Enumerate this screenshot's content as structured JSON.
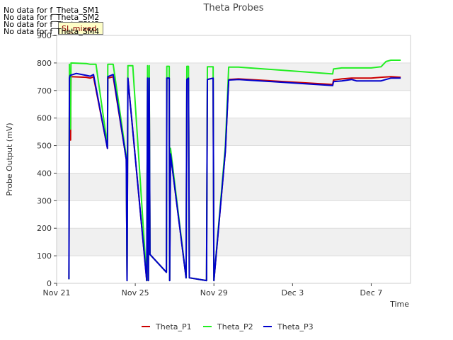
{
  "chart_data": {
    "type": "line",
    "title": "Theta Probes",
    "xlabel": "Time",
    "ylabel": "Probe Output (mV)",
    "xlim": [
      "2021-11-21",
      "2021-12-09"
    ],
    "ylim": [
      0,
      900
    ],
    "x_ticks": [
      "Nov 21",
      "Nov 25",
      "Nov 29",
      "Dec 3",
      "Dec 7"
    ],
    "y_ticks": [
      0,
      100,
      200,
      300,
      400,
      500,
      600,
      700,
      800,
      900
    ],
    "grid": true,
    "background_bands": true,
    "legend_position": "bottom-center",
    "series": [
      {
        "name": "Theta_P1",
        "color": "#cc0000",
        "points": [
          [
            "2021-11-21T15:00",
            15
          ],
          [
            "2021-11-21T15:40",
            750
          ],
          [
            "2021-11-21T17:00",
            520
          ],
          [
            "2021-11-21T17:30",
            750
          ],
          [
            "2021-11-22T12:00",
            748
          ],
          [
            "2021-11-22T17:00",
            745
          ],
          [
            "2021-11-22T21:00",
            750
          ],
          [
            "2021-11-23T14:00",
            490
          ],
          [
            "2021-11-23T14:30",
            745
          ],
          [
            "2021-11-23T21:00",
            750
          ],
          [
            "2021-11-24T13:00",
            450
          ],
          [
            "2021-11-24T14:00",
            10
          ],
          [
            "2021-11-24T15:00",
            745
          ],
          [
            "2021-11-25T14:00",
            10
          ],
          [
            "2021-11-25T15:00",
            745
          ],
          [
            "2021-11-25T16:00",
            10
          ],
          [
            "2021-11-25T17:00",
            745
          ],
          [
            "2021-11-25T18:00",
            105
          ],
          [
            "2021-11-26T14:00",
            40
          ],
          [
            "2021-11-26T14:30",
            745
          ],
          [
            "2021-11-26T17:30",
            745
          ],
          [
            "2021-11-26T18:00",
            10
          ],
          [
            "2021-11-26T19:00",
            470
          ],
          [
            "2021-11-27T14:00",
            20
          ],
          [
            "2021-11-27T15:00",
            740
          ],
          [
            "2021-11-27T17:00",
            745
          ],
          [
            "2021-11-27T18:00",
            20
          ],
          [
            "2021-11-28T15:00",
            10
          ],
          [
            "2021-11-28T16:00",
            740
          ],
          [
            "2021-11-28T23:00",
            745
          ],
          [
            "2021-11-29T00:00",
            10
          ],
          [
            "2021-11-29T14:00",
            480
          ],
          [
            "2021-11-29T18:00",
            740
          ],
          [
            "2021-11-30T06:00",
            742
          ],
          [
            "2021-12-05T01:00",
            722
          ],
          [
            "2021-12-05T02:00",
            738
          ],
          [
            "2021-12-05T12:00",
            742
          ],
          [
            "2021-12-06T00:00",
            745
          ],
          [
            "2021-12-07T00:00",
            745
          ],
          [
            "2021-12-07T12:00",
            748
          ],
          [
            "2021-12-08T00:00",
            750
          ],
          [
            "2021-12-08T12:00",
            748
          ]
        ]
      },
      {
        "name": "Theta_P2",
        "color": "#22ee22",
        "points": [
          [
            "2021-11-21T15:00",
            15
          ],
          [
            "2021-11-21T15:40",
            795
          ],
          [
            "2021-11-21T17:00",
            560
          ],
          [
            "2021-11-21T17:30",
            800
          ],
          [
            "2021-11-22T12:00",
            798
          ],
          [
            "2021-11-22T17:00",
            795
          ],
          [
            "2021-11-23T00:00",
            795
          ],
          [
            "2021-11-23T14:00",
            500
          ],
          [
            "2021-11-23T14:30",
            795
          ],
          [
            "2021-11-23T21:00",
            795
          ],
          [
            "2021-11-24T13:00",
            460
          ],
          [
            "2021-11-24T14:00",
            10
          ],
          [
            "2021-11-24T15:00",
            790
          ],
          [
            "2021-11-24T21:00",
            790
          ],
          [
            "2021-11-25T14:00",
            10
          ],
          [
            "2021-11-25T15:00",
            790
          ],
          [
            "2021-11-25T16:00",
            10
          ],
          [
            "2021-11-25T17:00",
            790
          ],
          [
            "2021-11-25T18:00",
            105
          ],
          [
            "2021-11-26T14:00",
            40
          ],
          [
            "2021-11-26T14:30",
            788
          ],
          [
            "2021-11-26T17:30",
            788
          ],
          [
            "2021-11-26T18:00",
            10
          ],
          [
            "2021-11-26T19:00",
            490
          ],
          [
            "2021-11-27T14:00",
            20
          ],
          [
            "2021-11-27T15:00",
            788
          ],
          [
            "2021-11-27T17:00",
            788
          ],
          [
            "2021-11-27T18:00",
            20
          ],
          [
            "2021-11-28T15:00",
            10
          ],
          [
            "2021-11-28T16:00",
            786
          ],
          [
            "2021-11-28T23:00",
            786
          ],
          [
            "2021-11-29T00:00",
            10
          ],
          [
            "2021-11-29T14:00",
            500
          ],
          [
            "2021-11-29T18:00",
            785
          ],
          [
            "2021-11-30T06:00",
            785
          ],
          [
            "2021-12-05T01:00",
            760
          ],
          [
            "2021-12-05T02:00",
            778
          ],
          [
            "2021-12-05T12:00",
            782
          ],
          [
            "2021-12-07T00:00",
            782
          ],
          [
            "2021-12-07T12:00",
            786
          ],
          [
            "2021-12-07T18:00",
            805
          ],
          [
            "2021-12-08T00:00",
            810
          ],
          [
            "2021-12-08T12:00",
            810
          ]
        ]
      },
      {
        "name": "Theta_P3",
        "color": "#0000cc",
        "points": [
          [
            "2021-11-21T15:00",
            15
          ],
          [
            "2021-11-21T15:40",
            745
          ],
          [
            "2021-11-21T16:30",
            755
          ],
          [
            "2021-11-22T00:00",
            762
          ],
          [
            "2021-11-22T12:00",
            755
          ],
          [
            "2021-11-22T17:00",
            752
          ],
          [
            "2021-11-22T21:00",
            758
          ],
          [
            "2021-11-23T14:00",
            490
          ],
          [
            "2021-11-23T14:30",
            750
          ],
          [
            "2021-11-23T21:00",
            758
          ],
          [
            "2021-11-24T13:00",
            450
          ],
          [
            "2021-11-24T14:00",
            10
          ],
          [
            "2021-11-24T15:00",
            745
          ],
          [
            "2021-11-25T14:00",
            10
          ],
          [
            "2021-11-25T15:00",
            745
          ],
          [
            "2021-11-25T16:00",
            10
          ],
          [
            "2021-11-25T17:00",
            745
          ],
          [
            "2021-11-25T18:00",
            105
          ],
          [
            "2021-11-26T14:00",
            40
          ],
          [
            "2021-11-26T14:30",
            745
          ],
          [
            "2021-11-26T17:30",
            745
          ],
          [
            "2021-11-26T18:00",
            10
          ],
          [
            "2021-11-26T19:00",
            470
          ],
          [
            "2021-11-27T14:00",
            20
          ],
          [
            "2021-11-27T15:00",
            740
          ],
          [
            "2021-11-27T17:00",
            745
          ],
          [
            "2021-11-27T18:00",
            20
          ],
          [
            "2021-11-28T15:00",
            10
          ],
          [
            "2021-11-28T16:00",
            740
          ],
          [
            "2021-11-28T23:00",
            745
          ],
          [
            "2021-11-29T00:00",
            10
          ],
          [
            "2021-11-29T14:00",
            480
          ],
          [
            "2021-11-29T18:00",
            738
          ],
          [
            "2021-11-30T06:00",
            740
          ],
          [
            "2021-12-05T01:00",
            718
          ],
          [
            "2021-12-05T02:00",
            732
          ],
          [
            "2021-12-05T12:00",
            735
          ],
          [
            "2021-12-06T00:00",
            740
          ],
          [
            "2021-12-06T06:00",
            735
          ],
          [
            "2021-12-07T12:00",
            735
          ],
          [
            "2021-12-07T18:00",
            740
          ],
          [
            "2021-12-08T00:00",
            745
          ],
          [
            "2021-12-08T12:00",
            745
          ]
        ]
      }
    ]
  },
  "nodata_messages": [
    "No data for f_Theta_SM1",
    "No data for f_Theta_SM2",
    "No data for f_Theta_SM3",
    "No data for f_Theta_SM4"
  ],
  "badge_label": "SI_mixed"
}
